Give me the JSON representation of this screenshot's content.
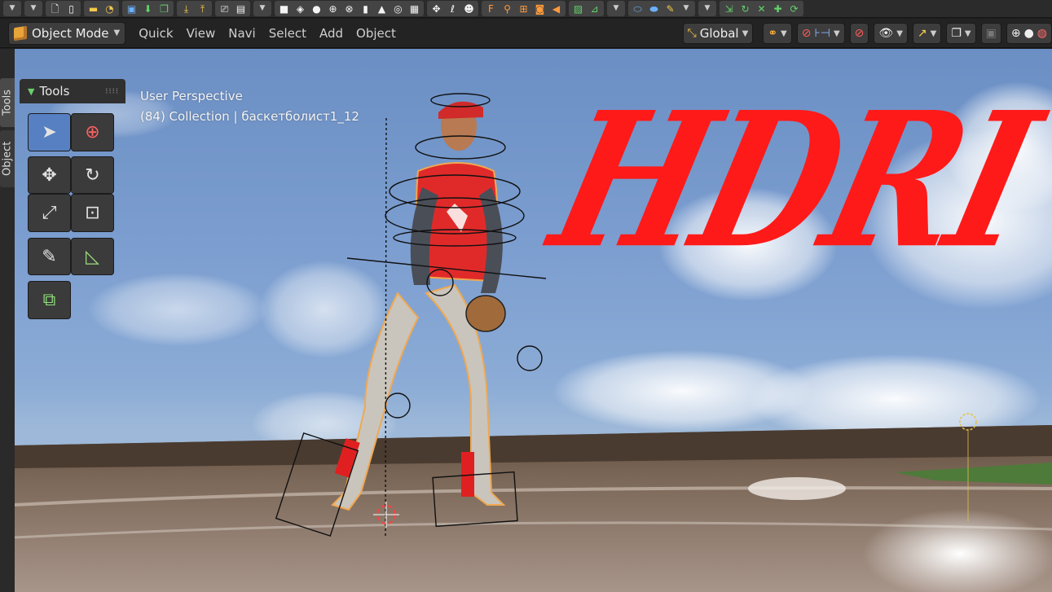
{
  "toolbar": {
    "icons": [
      "chevron-down-icon",
      "chevron-down-icon",
      "new-file-icon",
      "file-icon",
      "open-folder-icon",
      "recent-icon",
      "save-icon",
      "save-as-icon",
      "save-copy-icon",
      "import-icon",
      "export-icon",
      "render-icon",
      "render-animation-icon",
      "chevron-down-icon",
      "plane-icon",
      "cube-icon",
      "circle-icon",
      "uv-sphere-icon",
      "ico-sphere-icon",
      "cylinder-icon",
      "cone-icon",
      "torus-icon",
      "grid-icon",
      "transform-icon",
      "lasso-icon",
      "monkey-icon",
      "font-icon",
      "armature-icon",
      "lattice-icon",
      "camera-icon",
      "speaker-icon",
      "image-icon",
      "graph-icon",
      "chevron-down-icon",
      "material-icon",
      "shader-icon",
      "paint-icon",
      "chevron-down-icon",
      "snap-icon",
      "rotate-icon",
      "scale-icon",
      "move-icon",
      "refresh-icon"
    ]
  },
  "header": {
    "mode": "Object Mode",
    "menus": [
      "Quick",
      "View",
      "Navi",
      "Select",
      "Add",
      "Object"
    ],
    "orientation": "Global"
  },
  "side_tabs": {
    "tools": "Tools",
    "object": "Object"
  },
  "tools_panel": {
    "title": "Tools",
    "tools": [
      {
        "name": "select-tool",
        "icon": "select-arrow-icon"
      },
      {
        "name": "cursor-tool",
        "icon": "cursor-icon"
      },
      {
        "name": "move-tool",
        "icon": "move-icon"
      },
      {
        "name": "rotate-tool",
        "icon": "rotate-icon"
      },
      {
        "name": "scale-tool",
        "icon": "scale-icon"
      },
      {
        "name": "transform-tool",
        "icon": "transform-icon"
      },
      {
        "name": "annotate-tool",
        "icon": "annotate-icon"
      },
      {
        "name": "measure-tool",
        "icon": "measure-icon"
      },
      {
        "name": "add-cube-tool",
        "icon": "add-cube-icon"
      }
    ]
  },
  "viewport": {
    "perspective": "User Perspective",
    "collection": "(84) Collection | баскетболист1_12",
    "title_overlay": "HDRI"
  },
  "colors": {
    "accent": "#5680c2",
    "title": "#ff1a1a",
    "mode_icon": "#e8a43a"
  }
}
